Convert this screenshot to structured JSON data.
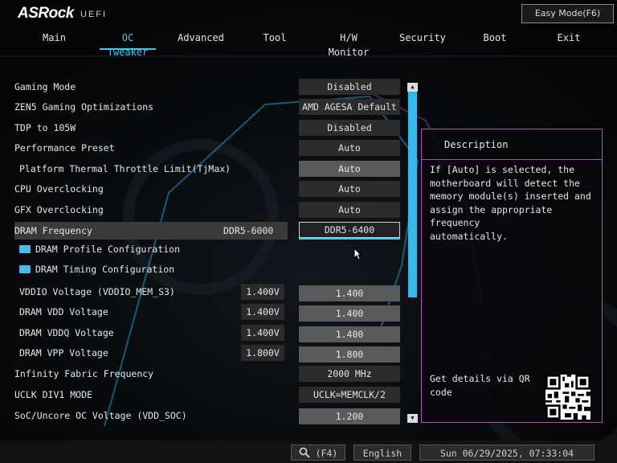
{
  "brand": {
    "logo": "ASRock",
    "sub": "UEFI"
  },
  "header": {
    "easy_mode_label": "Easy Mode(F6)"
  },
  "tabs": [
    {
      "label": "Main",
      "active": false
    },
    {
      "label": "OC Tweaker",
      "active": true
    },
    {
      "label": "Advanced",
      "active": false
    },
    {
      "label": "Tool",
      "active": false
    },
    {
      "label": "H/W Monitor",
      "active": false
    },
    {
      "label": "Security",
      "active": false
    },
    {
      "label": "Boot",
      "active": false
    },
    {
      "label": "Exit",
      "active": false
    }
  ],
  "settings": [
    {
      "label": "Gaming Mode",
      "value": "Disabled"
    },
    {
      "label": "ZEN5 Gaming Optimizations",
      "value": "AMD AGESA Default"
    },
    {
      "label": "TDP to 105W",
      "value": "Disabled"
    },
    {
      "label": "Performance Preset",
      "value": "Auto"
    },
    {
      "label": "Platform Thermal Throttle Limit(TjMax)",
      "value": "Auto"
    },
    {
      "label": "CPU Overclocking",
      "value": "Auto"
    },
    {
      "label": "GFX Overclocking",
      "value": "Auto"
    },
    {
      "label": "DRAM Frequency",
      "current": "DDR5-6000",
      "value": "DDR5-6400"
    },
    {
      "label": "DRAM Profile Configuration"
    },
    {
      "label": "DRAM Timing Configuration"
    },
    {
      "label": "VDDIO Voltage (VDDIO_MEM_S3)",
      "current": "1.400V",
      "value": "1.400"
    },
    {
      "label": "DRAM VDD Voltage",
      "current": "1.400V",
      "value": "1.400"
    },
    {
      "label": "DRAM VDDQ Voltage",
      "current": "1.400V",
      "value": "1.400"
    },
    {
      "label": "DRAM VPP Voltage",
      "current": "1.800V",
      "value": "1.800"
    },
    {
      "label": "Infinity Fabric Frequency",
      "value": "2000 MHz"
    },
    {
      "label": "UCLK DIV1 MODE",
      "value": "UCLK=MEMCLK/2"
    },
    {
      "label": "SoC/Uncore OC Voltage (VDD_SOC)",
      "value": "1.200"
    }
  ],
  "description": {
    "title": "Description",
    "text": "If [Auto] is selected, the\nmotherboard will detect the\nmemory module(s) inserted and\nassign the appropriate frequency\nautomatically.",
    "qr_label": "Get details via QR\ncode"
  },
  "footer": {
    "search_label": "(F4)",
    "language": "English",
    "datetime": "Sun 06/29/2025, 07:33:04"
  },
  "colors": {
    "accent": "#3fc8f4",
    "panel_border": "#b84fbf",
    "highlight_row": "#3a3a3a"
  }
}
